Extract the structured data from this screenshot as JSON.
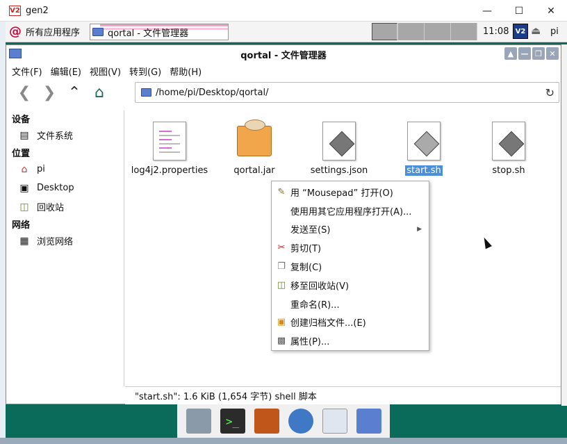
{
  "vnc": {
    "logo": "V2",
    "title": "gen2"
  },
  "panel": {
    "menu_label": "所有应用程序",
    "task_label": "qortal - 文件管理器",
    "clock": "11:08",
    "user": "pi",
    "tray_vnc": "V2"
  },
  "fm": {
    "title": "qortal - 文件管理器",
    "menus": [
      "文件(F)",
      "编辑(E)",
      "视图(V)",
      "转到(G)",
      "帮助(H)"
    ],
    "path": "/home/pi/Desktop/qortal/",
    "sidebar": {
      "devices_heading": "设备",
      "filesystem": "文件系统",
      "places_heading": "位置",
      "home": "pi",
      "desktop": "Desktop",
      "trash": "回收站",
      "network_heading": "网络",
      "browse_network": "浏览网络"
    },
    "files": [
      "log4j2.properties",
      "qortal.jar",
      "settings.json",
      "start.sh",
      "stop.sh"
    ],
    "status": "\"start.sh\": 1.6 KiB (1,654 字节) shell 脚本"
  },
  "context_menu": {
    "open_with_mousepad": "用 “Mousepad” 打开(O)",
    "open_with_other": "使用用其它应用程序打开(A)...",
    "send_to": "发送至(S)",
    "cut": "剪切(T)",
    "copy": "复制(C)",
    "move_to_trash": "移至回收站(V)",
    "rename": "重命名(R)...",
    "create_archive": "创建归档文件...(E)",
    "properties": "属性(P)..."
  }
}
